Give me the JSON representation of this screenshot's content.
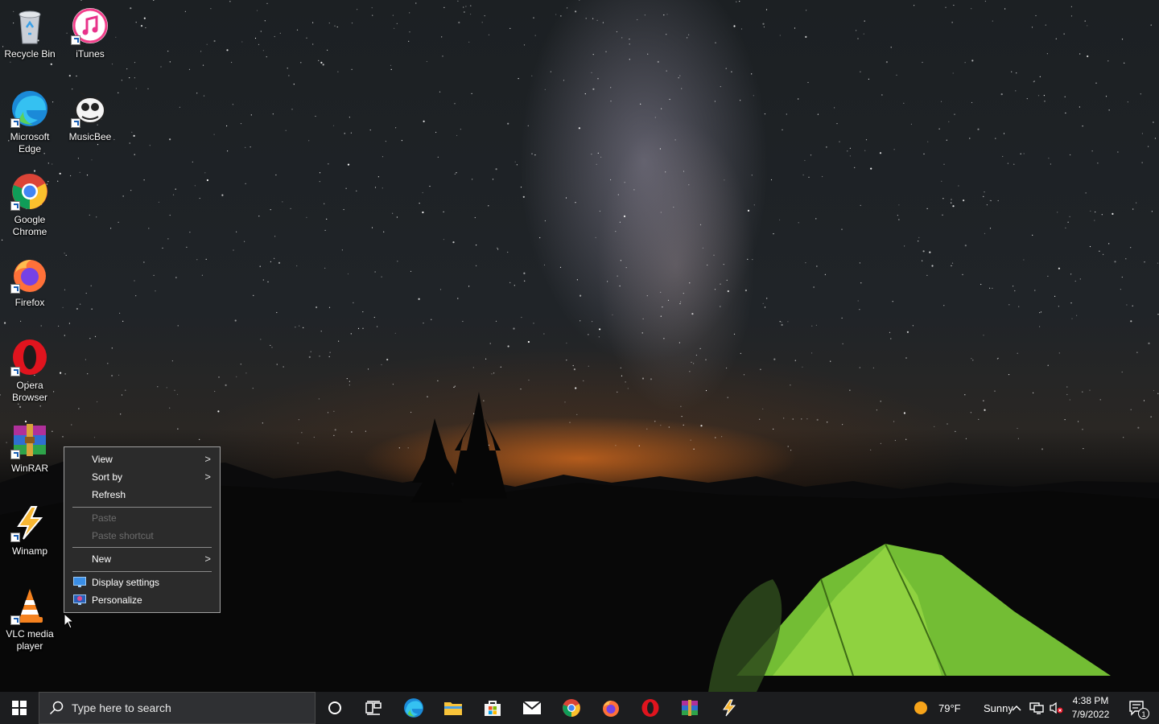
{
  "desktop": {
    "icons": [
      {
        "label_1": "Recycle Bin",
        "label_2": ""
      },
      {
        "label_1": "iTunes",
        "label_2": ""
      },
      {
        "label_1": "Microsoft",
        "label_2": "Edge"
      },
      {
        "label_1": "MusicBee",
        "label_2": ""
      },
      {
        "label_1": "Google",
        "label_2": "Chrome"
      },
      {
        "label_1": "Firefox",
        "label_2": ""
      },
      {
        "label_1": "Opera",
        "label_2": "Browser"
      },
      {
        "label_1": "WinRAR",
        "label_2": ""
      },
      {
        "label_1": "Winamp",
        "label_2": ""
      },
      {
        "label_1": "VLC media",
        "label_2": "player"
      }
    ]
  },
  "context_menu": {
    "items": [
      {
        "label": "View",
        "submenu": true,
        "enabled": true
      },
      {
        "label": "Sort by",
        "submenu": true,
        "enabled": true
      },
      {
        "label": "Refresh",
        "submenu": false,
        "enabled": true
      },
      {
        "label": "Paste",
        "submenu": false,
        "enabled": false
      },
      {
        "label": "Paste shortcut",
        "submenu": false,
        "enabled": false
      },
      {
        "label": "New",
        "submenu": true,
        "enabled": true
      },
      {
        "label": "Display settings",
        "submenu": false,
        "enabled": true,
        "icon": "display-settings-icon"
      },
      {
        "label": "Personalize",
        "submenu": false,
        "enabled": true,
        "icon": "personalize-icon"
      }
    ],
    "submenu_arrow": ">"
  },
  "taskbar": {
    "search_placeholder": "Type here to search",
    "pinned": [
      "cortana-icon",
      "task-view-icon",
      "edge-icon",
      "file-explorer-icon",
      "microsoft-store-icon",
      "mail-icon",
      "chrome-icon",
      "firefox-icon",
      "opera-icon",
      "winrar-icon",
      "winamp-icon"
    ],
    "weather": {
      "temperature": "79°F",
      "condition": "Sunny"
    },
    "clock": {
      "time": "4:38 PM",
      "date": "7/9/2022"
    },
    "notification_count": "1"
  },
  "colors": {
    "taskbar_bg": "#1c1d1f",
    "menu_bg": "#2b2b2b",
    "menu_disabled_text": "#6d6d6d",
    "tent_green": "#7fd23a"
  }
}
